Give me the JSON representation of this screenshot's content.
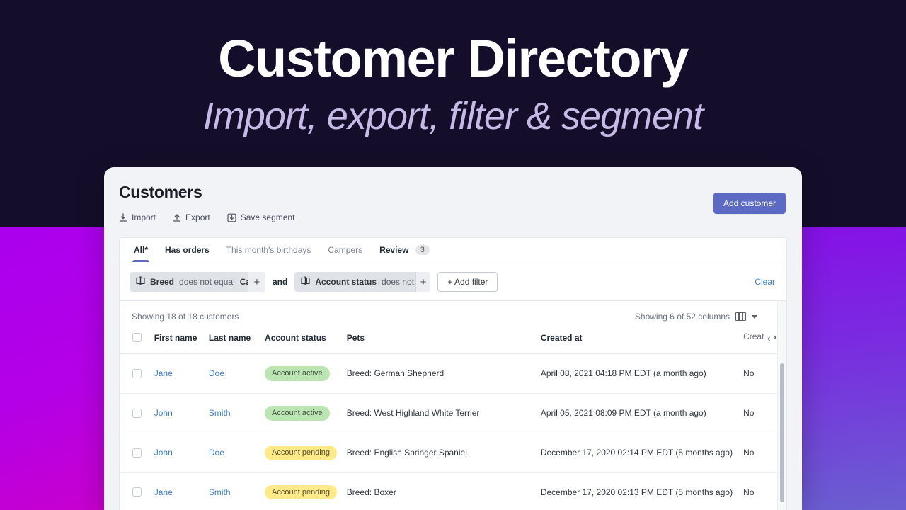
{
  "hero": {
    "title": "Customer Directory",
    "subtitle": "Import, export, filter & segment"
  },
  "app": {
    "page_title": "Customers",
    "add_customer_label": "Add customer",
    "actions": [
      {
        "label": "Import",
        "icon": "import-icon"
      },
      {
        "label": "Export",
        "icon": "export-icon"
      },
      {
        "label": "Save segment",
        "icon": "save-segment-icon"
      }
    ],
    "tabs": [
      {
        "label": "All*",
        "active": true,
        "badge": ""
      },
      {
        "label": "Has orders",
        "active": false,
        "badge": ""
      },
      {
        "label": "This month's birthdays",
        "active": false,
        "badge": ""
      },
      {
        "label": "Campers",
        "active": false,
        "badge": ""
      },
      {
        "label": "Review",
        "active": false,
        "badge": "3"
      }
    ],
    "filters": {
      "chips": [
        {
          "field": "Breed",
          "operator": "does not equal",
          "value": "Cat",
          "plus": "+",
          "icon": "filter-field-icon"
        },
        {
          "field": "Account status",
          "operator": "does not equal",
          "value": "",
          "plus": "+",
          "icon": "filter-field-icon"
        }
      ],
      "conjunction": "and",
      "add_filter_label": "+ Add filter",
      "clear_label": "Clear"
    },
    "table": {
      "showing_rows": "Showing 18 of 18 customers",
      "showing_columns": "Showing 6 of 52 columns",
      "columns_icon": "columns-icon",
      "columns_caret": "chevron-down-icon",
      "headers": {
        "first_name": "First name",
        "last_name": "Last name",
        "account_status": "Account status",
        "pets": "Pets",
        "created_at": "Created at",
        "created_clipped": "Creat"
      },
      "nav_prev": "‹",
      "nav_next": "›",
      "rows": [
        {
          "first_name": "Jane",
          "last_name": "Doe",
          "status": "Account active",
          "status_kind": "active",
          "pets": "Breed: German Shepherd",
          "created_at": "April 08, 2021 04:18 PM EDT (a month ago)",
          "last_col": "No"
        },
        {
          "first_name": "John",
          "last_name": "Smith",
          "status": "Account active",
          "status_kind": "active",
          "pets": "Breed: West Highland White Terrier",
          "created_at": "April 05, 2021 08:09 PM EDT (a month ago)",
          "last_col": "No"
        },
        {
          "first_name": "John",
          "last_name": "Doe",
          "status": "Account pending",
          "status_kind": "pending",
          "pets": "Breed: English Springer Spaniel",
          "created_at": "December 17, 2020 02:14 PM EDT (5 months ago)",
          "last_col": "No"
        },
        {
          "first_name": "Jane",
          "last_name": "Smith",
          "status": "Account pending",
          "status_kind": "pending",
          "pets": "Breed: Boxer",
          "created_at": "December 17, 2020 02:13 PM EDT (5 months ago)",
          "last_col": "No"
        }
      ]
    }
  },
  "colors": {
    "backdrop_navy": "#150e2b",
    "accent_button": "#5c6ac4",
    "link_blue": "#3b7fc4",
    "pill_active_bg": "#bbe5b3",
    "pill_pending_bg": "#ffea8a",
    "gradient_magenta": "#d400c0",
    "gradient_purple": "#aa00ee",
    "gradient_blue_purple": "#6a5fd0"
  }
}
